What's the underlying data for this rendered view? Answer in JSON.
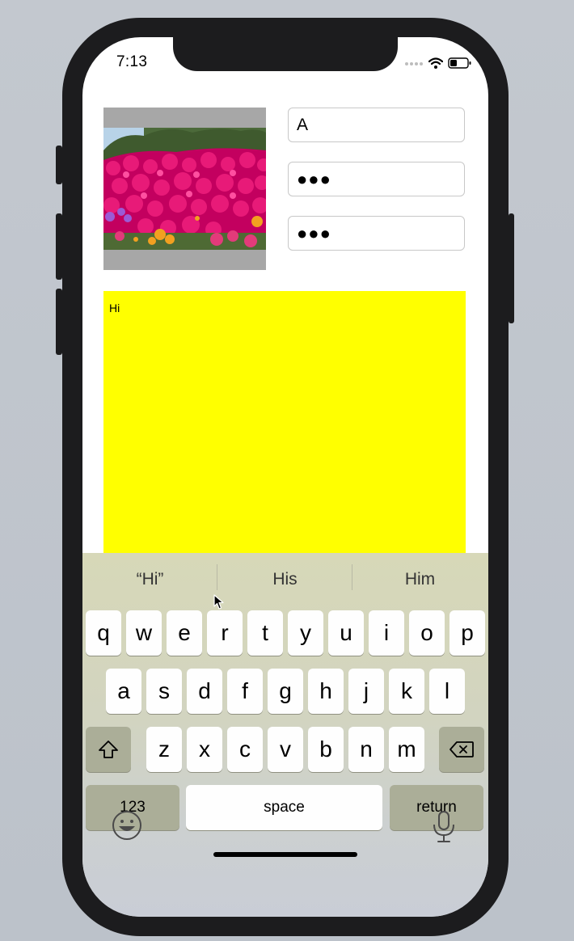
{
  "status_bar": {
    "time": "7:13"
  },
  "form": {
    "field1_value": "A",
    "field2_value": "●●●",
    "field3_value": "●●●",
    "textarea_text": "Hi",
    "textarea_color": "#ffff00"
  },
  "keyboard": {
    "suggestions": [
      "“Hi”",
      "His",
      "Him"
    ],
    "row1": [
      "q",
      "w",
      "e",
      "r",
      "t",
      "y",
      "u",
      "i",
      "o",
      "p"
    ],
    "row2": [
      "a",
      "s",
      "d",
      "f",
      "g",
      "h",
      "j",
      "k",
      "l"
    ],
    "row3": [
      "z",
      "x",
      "c",
      "v",
      "b",
      "n",
      "m"
    ],
    "numbers_label": "123",
    "space_label": "space",
    "return_label": "return",
    "shift_icon": "shift-icon",
    "backspace_icon": "backspace-icon",
    "emoji_icon": "emoji-icon",
    "mic_icon": "microphone-icon"
  }
}
